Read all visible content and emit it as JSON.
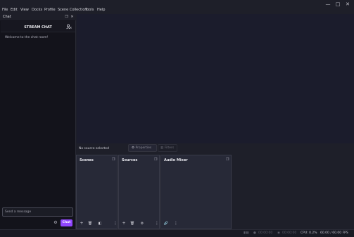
{
  "menubar": {
    "items": [
      "File",
      "Edit",
      "View",
      "Docks",
      "Profile",
      "Scene Collection",
      "Tools",
      "Help"
    ],
    "window_controls": [
      "—",
      "□",
      "✕"
    ]
  },
  "chat_dock": {
    "title": "Chat",
    "header_title": "STREAM CHAT",
    "welcome": "Welcome to the chat room!",
    "input_placeholder": "Send a message",
    "send_label": "Chat",
    "send_color": "#9146ff"
  },
  "preview": {
    "no_source": "No source selected",
    "properties_label": "Properties",
    "filters_label": "Filters"
  },
  "docks": {
    "scenes_title": "Scenes",
    "sources_title": "Sources",
    "audio_mixer_title": "Audio Mixer"
  },
  "statusbar": {
    "rec_time": "00:00:00",
    "stream_time": "00:00:00",
    "cpu": "CPU: 0.2%",
    "fps": "60.00 / 60.00 FPS"
  },
  "icons": {
    "minimize": "minimize-icon",
    "maximize": "maximize-icon",
    "close": "close-icon",
    "float": "float-dock-icon",
    "user": "user-icon",
    "gear": "gear-icon",
    "add": "plus-icon",
    "remove": "trash-icon",
    "filter": "filter-icon",
    "more": "more-icon",
    "link": "link-icon"
  }
}
